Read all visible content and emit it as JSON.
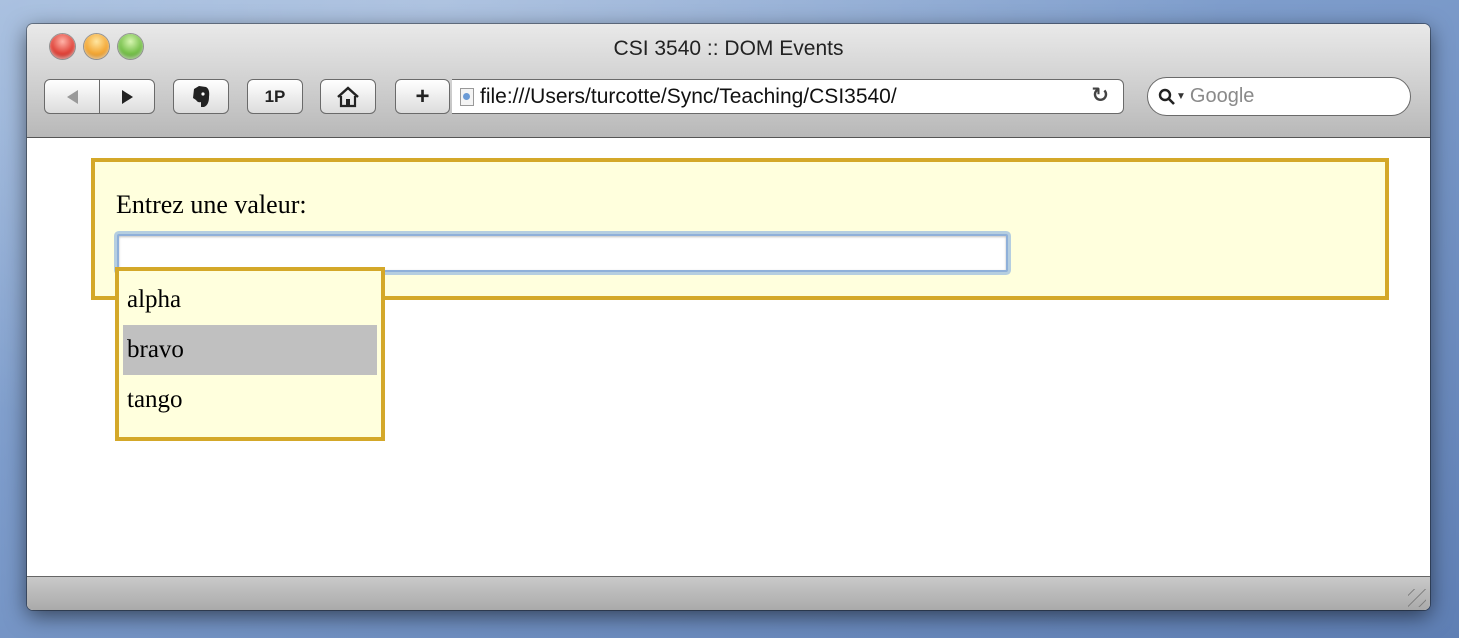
{
  "window": {
    "title": "CSI 3540 :: DOM Events"
  },
  "toolbar": {
    "onepassword_label": "1P",
    "add_label": "+",
    "url": "file:///Users/turcotte/Sync/Teaching/CSI3540/",
    "reload_icon": "↻",
    "search_placeholder": "Google"
  },
  "page": {
    "prompt_label": "Entrez une valeur:",
    "input_value": "",
    "suggestions": [
      {
        "label": "alpha",
        "selected": false
      },
      {
        "label": "bravo",
        "selected": true
      },
      {
        "label": "tango",
        "selected": false
      }
    ]
  },
  "colors": {
    "box_background": "#ffffdd",
    "box_border": "#d4a829",
    "selected_item": "#c0c0c0"
  }
}
